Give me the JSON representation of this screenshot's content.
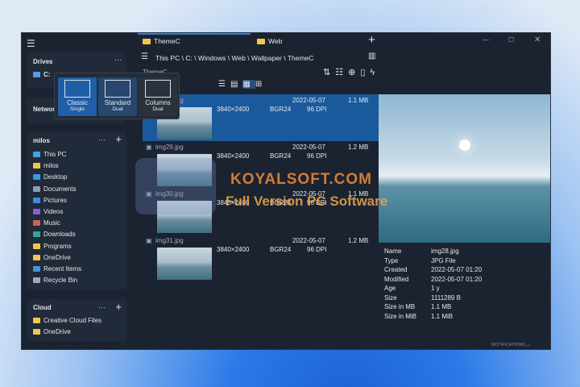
{
  "window": {
    "controls": [
      "minimize",
      "maximize",
      "close"
    ]
  },
  "sidebar": {
    "drives": {
      "title": "Drives",
      "items": [
        {
          "label": "C:"
        }
      ]
    },
    "network": {
      "title": "Network"
    },
    "user": {
      "title": "milos",
      "items": [
        {
          "label": "This PC",
          "color": "#3aa6e8"
        },
        {
          "label": "milos",
          "color": "#f2c64b"
        },
        {
          "label": "Desktop",
          "color": "#2fa0e0"
        },
        {
          "label": "Documents",
          "color": "#8a9bb0"
        },
        {
          "label": "Pictures",
          "color": "#3a8fe0"
        },
        {
          "label": "Videos",
          "color": "#8e5bd8"
        },
        {
          "label": "Music",
          "color": "#d0605a"
        },
        {
          "label": "Downloads",
          "color": "#2aa890"
        },
        {
          "label": "Programs",
          "color": "#f2c64b"
        },
        {
          "label": "OneDrive",
          "color": "#f2c64b"
        },
        {
          "label": "Recent Items",
          "color": "#4a8fd8"
        },
        {
          "label": "Recycle Bin",
          "color": "#a0aab5"
        }
      ]
    },
    "cloud": {
      "title": "Cloud",
      "items": [
        {
          "label": "Creative Cloud Files",
          "color": "#f2c64b"
        },
        {
          "label": "OneDrive",
          "color": "#f2c64b"
        }
      ]
    }
  },
  "tabs": [
    {
      "label": "ThemeC",
      "active": true
    },
    {
      "label": "Web",
      "active": false
    }
  ],
  "address": {
    "segments": [
      "This PC",
      "C:",
      "Windows",
      "Web",
      "Wallpaper",
      "ThemeC"
    ]
  },
  "folder_title": "ThemeC",
  "layout_popup": [
    {
      "title": "Classic",
      "sub": "Single"
    },
    {
      "title": "Standard",
      "sub": "Dual"
    },
    {
      "title": "Columns",
      "sub": "Dual"
    }
  ],
  "files": [
    {
      "name": "img28.jpg",
      "dims": "3840×2400",
      "format": "BGR24",
      "date": "2022-05-07",
      "dpi": "96 DPI",
      "size": "1.1 MB",
      "selected": true
    },
    {
      "name": "img29.jpg",
      "dims": "3840×2400",
      "format": "BGR24",
      "date": "2022-05-07",
      "dpi": "96 DPI",
      "size": "1.2 MB"
    },
    {
      "name": "img30.jpg",
      "dims": "3840×2400",
      "format": "BGR24",
      "date": "2022-05-07",
      "dpi": "96 DPI",
      "size": "1.1 MB"
    },
    {
      "name": "img31.jpg",
      "dims": "3840×2400",
      "format": "BGR24",
      "date": "2022-05-07",
      "dpi": "96 DPI",
      "size": "1.2 MB"
    }
  ],
  "properties": [
    {
      "k": "Name",
      "v": "img28.jpg"
    },
    {
      "k": "Type",
      "v": "JPG File"
    },
    {
      "k": "Created",
      "v": "2022-05-07  01:20"
    },
    {
      "k": "Modified",
      "v": "2022-05-07  01:20"
    },
    {
      "k": "Age",
      "v": "1 y"
    },
    {
      "k": "Size",
      "v": "1111289 B"
    },
    {
      "k": "Size in MB",
      "v": "1.1 MB"
    },
    {
      "k": "Size in MiB",
      "v": "1.1 MiB"
    }
  ],
  "status": {
    "notifications": "NOTIFICATIONS"
  },
  "watermark": {
    "line1": "KOYALSOFT.COM",
    "line2": "Full Version PC Software"
  }
}
